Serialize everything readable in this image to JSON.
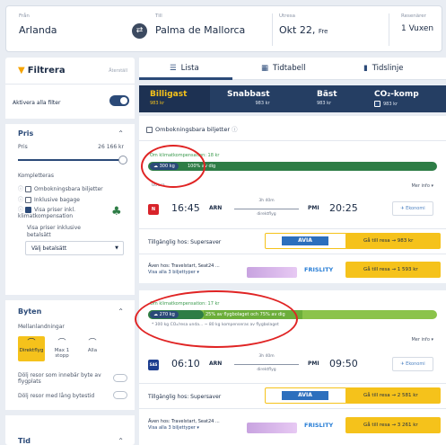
{
  "search": {
    "from_label": "Från",
    "from_value": "Arlanda",
    "to_label": "Till",
    "to_value": "Palma de Mallorca",
    "date_label": "Utresa",
    "date_value": "Okt 22,",
    "date_day": "Fre",
    "travelers_label": "Resenärer",
    "travelers_value": "1 Vuxen"
  },
  "sidebar": {
    "title": "Filtrera",
    "reset": "Återställ",
    "enable_all": "Aktivera alla filter",
    "price_title": "Pris",
    "price_label": "Pris",
    "price_max": "26 166 kr",
    "complement_title": "Kompletteras",
    "opt_rebook": "Ombokningsbara biljetter",
    "opt_baggage": "Inklusive bagage",
    "opt_climate": "Visa priser inkl. klimatkompensation",
    "show_prices_incl": "Visa priser inklusive",
    "currency_label": "betalsätt",
    "payment_select": "Välj betalsätt",
    "stops_title": "Byten",
    "stops_subtitle": "Mellanlandningar",
    "stop_options": [
      "Direktflyg",
      "Max 1 stopp",
      "Alla"
    ],
    "only_same_airport": "Dölj resor som innebär byte av flygplats",
    "only_night": "Dölj resor med lång bytestid",
    "time_title": "Tid"
  },
  "tabs": [
    "Lista",
    "Tidtabell",
    "Tidslinje"
  ],
  "sort": [
    {
      "label": "Billigast",
      "price": "983 kr"
    },
    {
      "label": "Snabbast",
      "price": "983 kr"
    },
    {
      "label": "Bäst",
      "price": "983 kr"
    },
    {
      "label": "CO₂-komp",
      "price": "983 kr"
    }
  ],
  "rebook_filter": "Ombokningsbara biljetter",
  "results": [
    {
      "climate_label": "Om klimatkompensation: 18 kr",
      "climate_badge": "300 kg",
      "climate_text": "100% av dig",
      "more": "Mer info",
      "airline_code": "N",
      "dep_time": "16:45",
      "dep_airport": "ARN",
      "duration": "3h 40m",
      "stops": "direktflyg",
      "arr_airport": "PMI",
      "arr_time": "20:25",
      "flight_btn": "Ekonomi",
      "available": "Tillgänglig hos: Supersaver",
      "partner_logo": "AVIA",
      "go_btn": "Gå till resa → 983 kr",
      "other_line1": "Även hos: Travelstart, Seat24 ...",
      "other_line2": "Visa alla 3 biljettyper",
      "fly_logo": "FRISLITY",
      "go_btn2": "Gå till resa → 1 593 kr"
    },
    {
      "climate_label": "Om klimatkompensation: 17 kr",
      "climate_badge": "270 kg",
      "climate_text": "25% av flygbolaget och 75% av dig",
      "climate_note": "* 300 kg CO₂/resa unda... ~ 80 kg kompenseras av flygbolaget",
      "more": "Mer info",
      "airline_code": "SAS",
      "dep_time": "06:10",
      "dep_airport": "ARN",
      "duration": "3h 40m",
      "stops": "direktflyg",
      "arr_airport": "PMI",
      "arr_time": "09:50",
      "flight_btn": "Ekonomi",
      "available": "Tillgänglig hos: Supersaver",
      "partner_logo": "AVIA",
      "go_btn": "Gå till resa → 2 581 kr",
      "other_line1": "Även hos: Travelstart, Seat24 ...",
      "other_line2": "Visa alla 3 biljettyper",
      "fly_logo": "FRISLITY",
      "go_btn2": "Gå till resa → 3 261 kr"
    }
  ],
  "colors": {
    "navy": "#253e63",
    "accent_yellow": "#f5c21b",
    "climate_green": "#2e7d46",
    "annotation_red": "#e02424"
  }
}
